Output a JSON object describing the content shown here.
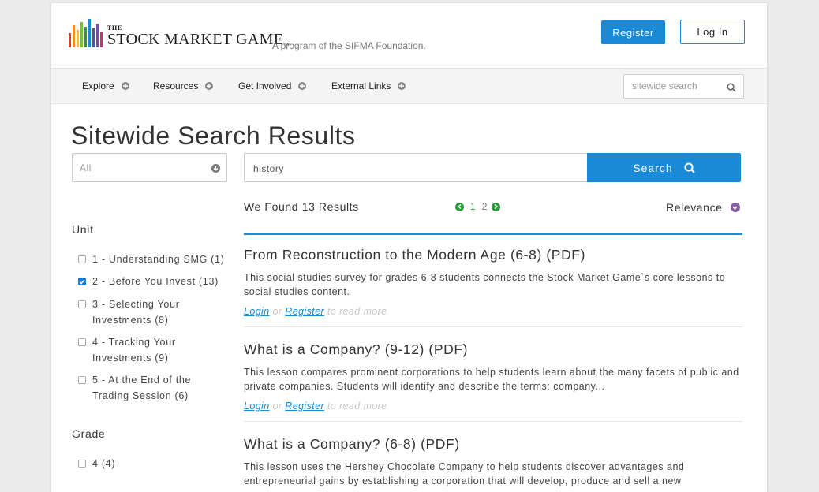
{
  "header": {
    "logo_the": "THE",
    "logo_name": "STOCK MARKET GAME",
    "logo_tm": "TM",
    "tagline": "A program of the SIFMA Foundation.",
    "register_label": "Register",
    "login_label": "Log In",
    "logo_bar_colors": [
      "#e03c31",
      "#f28c28",
      "#f7c11c",
      "#7bbf3a",
      "#2a9a3a",
      "#1a8ad6",
      "#3b5bb8",
      "#7a4ea0",
      "#c0367a"
    ]
  },
  "nav": {
    "items": [
      {
        "label": "Explore"
      },
      {
        "label": "Resources"
      },
      {
        "label": "Get Involved"
      },
      {
        "label": "External Links"
      }
    ],
    "search_placeholder": "sitewide search"
  },
  "main": {
    "title": "Sitewide Search Results",
    "filter_value": "All",
    "query_value": "history",
    "search_button_label": "Search",
    "found_text": "We Found 13 Results",
    "pages": [
      "1",
      "2"
    ],
    "sort_label": "Relevance"
  },
  "sidebar": {
    "unit_heading": "Unit",
    "unit_items": [
      {
        "label": "1 - Understanding SMG (1)",
        "checked": false
      },
      {
        "label": "2 - Before You Invest (13)",
        "checked": true
      },
      {
        "label": "3 - Selecting Your Investments (8)",
        "checked": false
      },
      {
        "label": "4 - Tracking Your Investments (9)",
        "checked": false
      },
      {
        "label": "5 - At the End of the Trading Session (6)",
        "checked": false
      }
    ],
    "grade_heading": "Grade",
    "grade_items": [
      {
        "label": "4 (4)",
        "checked": false
      }
    ]
  },
  "results": [
    {
      "title": "From Reconstruction to the Modern Age (6-8) (PDF)",
      "description": "This social studies survey for grades 6-8 students connects the Stock Market Game`s core lessons to social studies content.",
      "login": "Login",
      "or": "or",
      "register": "Register",
      "tail": "to read more"
    },
    {
      "title": "What is a Company? (9-12) (PDF)",
      "description": "This lesson compares prominent corporations to help students learn about the many facets of public and private companies. Students will identify and describe the terms: company...",
      "login": "Login",
      "or": "or",
      "register": "Register",
      "tail": "to read more"
    },
    {
      "title": "What is a Company? (6-8) (PDF)",
      "description": "This lesson uses the Hershey Chocolate Company to help students discover advantages and entrepreneurial gains by establishing a corporation that will develop, produce and sell a new"
    }
  ],
  "colors": {
    "accent": "#1a8ad6",
    "pager_green": "#2a9a3a",
    "sort_purple": "#8a5ca0"
  }
}
